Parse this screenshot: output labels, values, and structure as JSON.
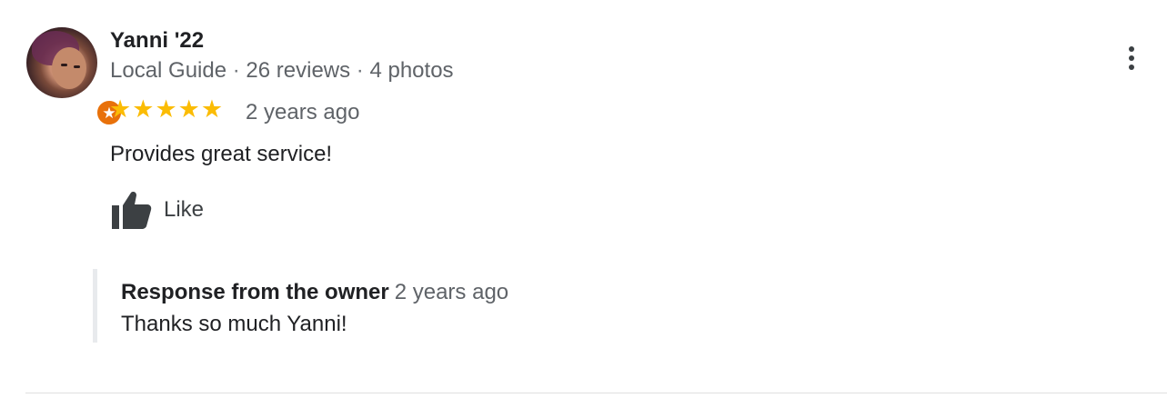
{
  "reviewer": {
    "name": "Yanni '22",
    "level": "Local Guide",
    "separator": " · ",
    "reviews_count": "26 reviews",
    "photos_count": "4 photos",
    "badge_icon": "local-guide-star-icon"
  },
  "rating": {
    "stars": 5,
    "max_stars": 5,
    "star_glyph": "★",
    "star_color": "#fbbc04",
    "time_ago": "2 years ago"
  },
  "review": {
    "text": "Provides great service!"
  },
  "actions": {
    "like_label": "Like",
    "like_icon": "thumbs-up-icon",
    "more_icon": "more-vert-icon"
  },
  "owner_response": {
    "title": "Response from the owner",
    "time_ago": "2 years ago",
    "text": "Thanks so much Yanni!"
  },
  "colors": {
    "badge": "#e8710a",
    "response_bar": "#e8eaed",
    "secondary_text": "#5f6368"
  }
}
